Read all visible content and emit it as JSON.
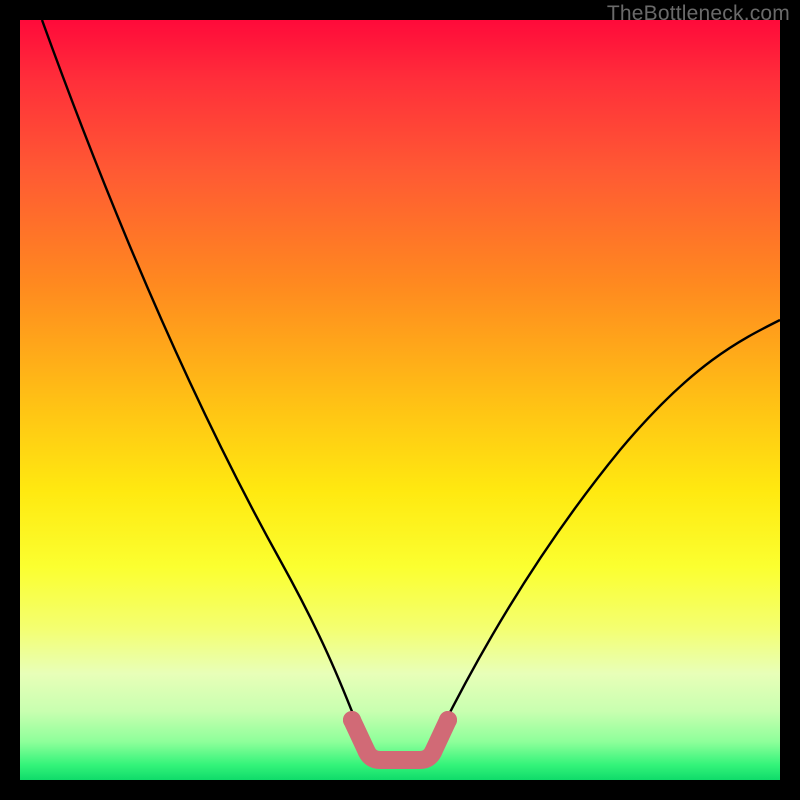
{
  "watermark": {
    "text": "TheBottleneck.com"
  },
  "colors": {
    "curve_stroke": "#000000",
    "bottom_marker_stroke": "#d16a76",
    "bottom_marker_fill": "none"
  },
  "chart_data": {
    "type": "line",
    "title": "",
    "xlabel": "",
    "ylabel": "",
    "xlim": [
      0,
      100
    ],
    "ylim": [
      0,
      100
    ],
    "grid": false,
    "legend": false,
    "annotations": [],
    "series": [
      {
        "name": "left-branch",
        "x": [
          3,
          6,
          10,
          15,
          20,
          25,
          30,
          35,
          40,
          43,
          45
        ],
        "y": [
          100,
          90,
          78,
          64,
          52,
          41,
          31,
          22,
          12,
          6,
          3
        ]
      },
      {
        "name": "valley-floor",
        "x": [
          45,
          47,
          50,
          53,
          55
        ],
        "y": [
          3,
          2.2,
          2,
          2.2,
          3
        ]
      },
      {
        "name": "right-branch",
        "x": [
          55,
          58,
          62,
          68,
          75,
          82,
          90,
          97,
          100
        ],
        "y": [
          3,
          7,
          13,
          22,
          32,
          41,
          50,
          57,
          60
        ]
      }
    ],
    "markers": {
      "name": "valley-highlight",
      "style": "thick-rounded",
      "color": "#d16a76",
      "x": [
        44,
        46,
        48,
        50,
        52,
        54,
        56
      ],
      "y": [
        4.5,
        2.8,
        2.2,
        2.0,
        2.2,
        2.8,
        4.5
      ]
    }
  }
}
